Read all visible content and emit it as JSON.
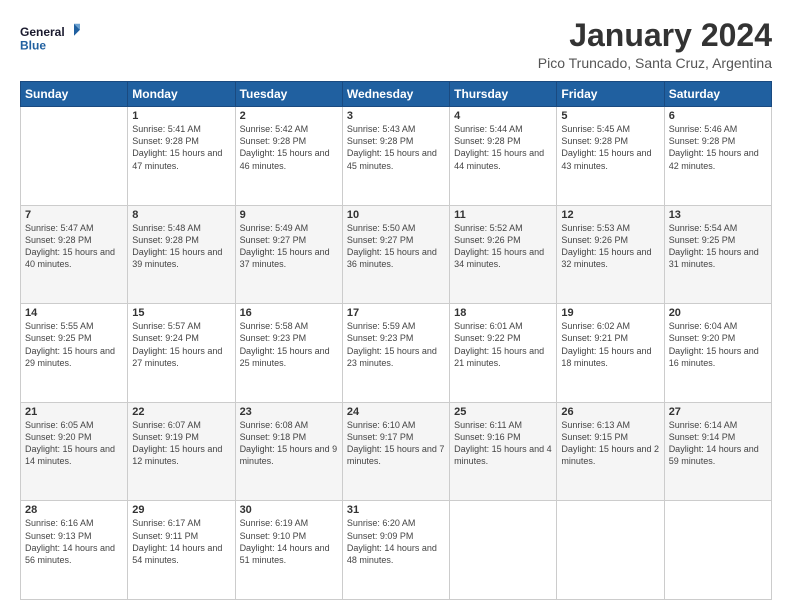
{
  "logo": {
    "line1": "General",
    "line2": "Blue"
  },
  "title": "January 2024",
  "subtitle": "Pico Truncado, Santa Cruz, Argentina",
  "headers": [
    "Sunday",
    "Monday",
    "Tuesday",
    "Wednesday",
    "Thursday",
    "Friday",
    "Saturday"
  ],
  "weeks": [
    [
      {
        "day": "",
        "info": ""
      },
      {
        "day": "1",
        "info": "Sunrise: 5:41 AM\nSunset: 9:28 PM\nDaylight: 15 hours\nand 47 minutes."
      },
      {
        "day": "2",
        "info": "Sunrise: 5:42 AM\nSunset: 9:28 PM\nDaylight: 15 hours\nand 46 minutes."
      },
      {
        "day": "3",
        "info": "Sunrise: 5:43 AM\nSunset: 9:28 PM\nDaylight: 15 hours\nand 45 minutes."
      },
      {
        "day": "4",
        "info": "Sunrise: 5:44 AM\nSunset: 9:28 PM\nDaylight: 15 hours\nand 44 minutes."
      },
      {
        "day": "5",
        "info": "Sunrise: 5:45 AM\nSunset: 9:28 PM\nDaylight: 15 hours\nand 43 minutes."
      },
      {
        "day": "6",
        "info": "Sunrise: 5:46 AM\nSunset: 9:28 PM\nDaylight: 15 hours\nand 42 minutes."
      }
    ],
    [
      {
        "day": "7",
        "info": "Sunrise: 5:47 AM\nSunset: 9:28 PM\nDaylight: 15 hours\nand 40 minutes."
      },
      {
        "day": "8",
        "info": "Sunrise: 5:48 AM\nSunset: 9:28 PM\nDaylight: 15 hours\nand 39 minutes."
      },
      {
        "day": "9",
        "info": "Sunrise: 5:49 AM\nSunset: 9:27 PM\nDaylight: 15 hours\nand 37 minutes."
      },
      {
        "day": "10",
        "info": "Sunrise: 5:50 AM\nSunset: 9:27 PM\nDaylight: 15 hours\nand 36 minutes."
      },
      {
        "day": "11",
        "info": "Sunrise: 5:52 AM\nSunset: 9:26 PM\nDaylight: 15 hours\nand 34 minutes."
      },
      {
        "day": "12",
        "info": "Sunrise: 5:53 AM\nSunset: 9:26 PM\nDaylight: 15 hours\nand 32 minutes."
      },
      {
        "day": "13",
        "info": "Sunrise: 5:54 AM\nSunset: 9:25 PM\nDaylight: 15 hours\nand 31 minutes."
      }
    ],
    [
      {
        "day": "14",
        "info": "Sunrise: 5:55 AM\nSunset: 9:25 PM\nDaylight: 15 hours\nand 29 minutes."
      },
      {
        "day": "15",
        "info": "Sunrise: 5:57 AM\nSunset: 9:24 PM\nDaylight: 15 hours\nand 27 minutes."
      },
      {
        "day": "16",
        "info": "Sunrise: 5:58 AM\nSunset: 9:23 PM\nDaylight: 15 hours\nand 25 minutes."
      },
      {
        "day": "17",
        "info": "Sunrise: 5:59 AM\nSunset: 9:23 PM\nDaylight: 15 hours\nand 23 minutes."
      },
      {
        "day": "18",
        "info": "Sunrise: 6:01 AM\nSunset: 9:22 PM\nDaylight: 15 hours\nand 21 minutes."
      },
      {
        "day": "19",
        "info": "Sunrise: 6:02 AM\nSunset: 9:21 PM\nDaylight: 15 hours\nand 18 minutes."
      },
      {
        "day": "20",
        "info": "Sunrise: 6:04 AM\nSunset: 9:20 PM\nDaylight: 15 hours\nand 16 minutes."
      }
    ],
    [
      {
        "day": "21",
        "info": "Sunrise: 6:05 AM\nSunset: 9:20 PM\nDaylight: 15 hours\nand 14 minutes."
      },
      {
        "day": "22",
        "info": "Sunrise: 6:07 AM\nSunset: 9:19 PM\nDaylight: 15 hours\nand 12 minutes."
      },
      {
        "day": "23",
        "info": "Sunrise: 6:08 AM\nSunset: 9:18 PM\nDaylight: 15 hours\nand 9 minutes."
      },
      {
        "day": "24",
        "info": "Sunrise: 6:10 AM\nSunset: 9:17 PM\nDaylight: 15 hours\nand 7 minutes."
      },
      {
        "day": "25",
        "info": "Sunrise: 6:11 AM\nSunset: 9:16 PM\nDaylight: 15 hours\nand 4 minutes."
      },
      {
        "day": "26",
        "info": "Sunrise: 6:13 AM\nSunset: 9:15 PM\nDaylight: 15 hours\nand 2 minutes."
      },
      {
        "day": "27",
        "info": "Sunrise: 6:14 AM\nSunset: 9:14 PM\nDaylight: 14 hours\nand 59 minutes."
      }
    ],
    [
      {
        "day": "28",
        "info": "Sunrise: 6:16 AM\nSunset: 9:13 PM\nDaylight: 14 hours\nand 56 minutes."
      },
      {
        "day": "29",
        "info": "Sunrise: 6:17 AM\nSunset: 9:11 PM\nDaylight: 14 hours\nand 54 minutes."
      },
      {
        "day": "30",
        "info": "Sunrise: 6:19 AM\nSunset: 9:10 PM\nDaylight: 14 hours\nand 51 minutes."
      },
      {
        "day": "31",
        "info": "Sunrise: 6:20 AM\nSunset: 9:09 PM\nDaylight: 14 hours\nand 48 minutes."
      },
      {
        "day": "",
        "info": ""
      },
      {
        "day": "",
        "info": ""
      },
      {
        "day": "",
        "info": ""
      }
    ]
  ]
}
